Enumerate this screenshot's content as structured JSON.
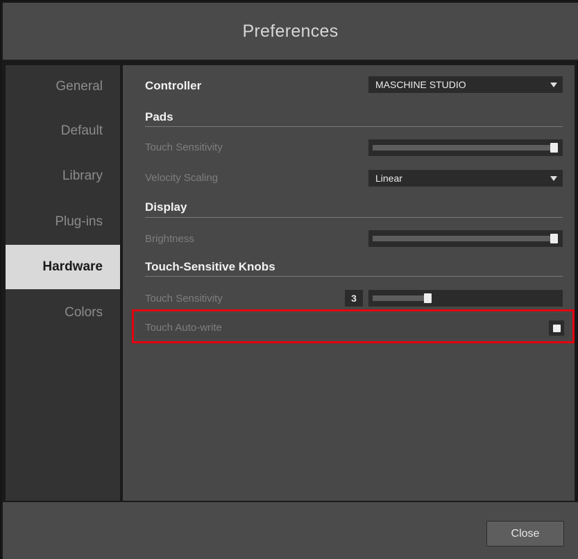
{
  "window": {
    "title": "Preferences"
  },
  "sidebar": {
    "items": [
      {
        "label": "General",
        "active": false
      },
      {
        "label": "Default",
        "active": false
      },
      {
        "label": "Library",
        "active": false
      },
      {
        "label": "Plug-ins",
        "active": false
      },
      {
        "label": "Hardware",
        "active": true
      },
      {
        "label": "Colors",
        "active": false
      }
    ]
  },
  "hardware": {
    "controller": {
      "label": "Controller",
      "value": "MASCHINE STUDIO"
    },
    "pads": {
      "heading": "Pads",
      "touch_sensitivity": {
        "label": "Touch Sensitivity",
        "level": 1.0
      },
      "velocity_scaling": {
        "label": "Velocity Scaling",
        "value": "Linear"
      }
    },
    "display": {
      "heading": "Display",
      "brightness": {
        "label": "Brightness",
        "level": 1.0
      }
    },
    "touch_knobs": {
      "heading": "Touch-Sensitive Knobs",
      "touch_sensitivity": {
        "label": "Touch Sensitivity",
        "value": "3",
        "level": 0.3
      },
      "touch_auto_write": {
        "label": "Touch Auto-write",
        "checked": true
      }
    }
  },
  "footer": {
    "close_label": "Close"
  },
  "colors": {
    "highlight": "#e3000f",
    "active_tab": "#d9d9d9"
  }
}
